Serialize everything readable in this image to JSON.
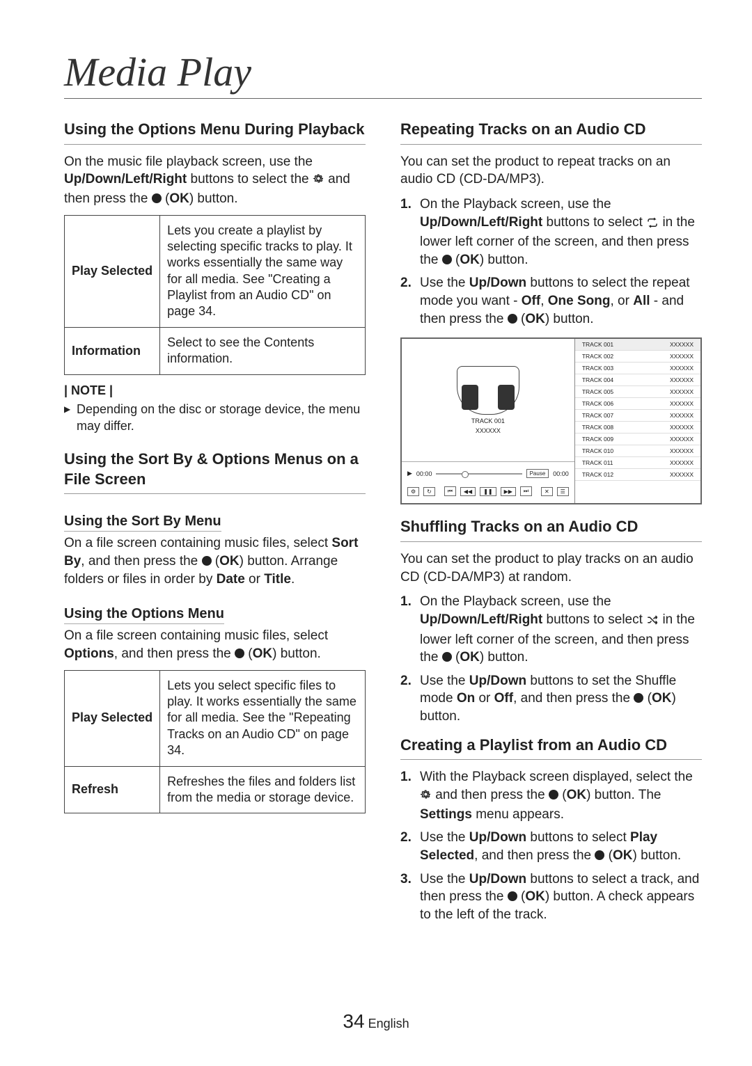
{
  "page_title": "Media Play",
  "footer": {
    "page_number": "34",
    "language": "English"
  },
  "left": {
    "sec1_title": "Using the Options Menu During Playback",
    "sec1_body_parts": [
      "On the music file playback screen, use the ",
      "Up/Down/Left/Right",
      " buttons to select the ",
      " and then press the ",
      " (",
      "OK",
      ") button."
    ],
    "table1": {
      "r1_label": "Play Selected",
      "r1_desc": "Lets you create a playlist by selecting specific tracks to play. It works essentially the same way for all media. See \"Creating a Playlist from an Audio CD\" on page 34.",
      "r2_label": "Information",
      "r2_desc": "Select to see the Contents information."
    },
    "note_hd": "| NOTE |",
    "note_body": "Depending on the disc or storage device, the menu may differ.",
    "sec2_title": "Using the Sort By & Options Menus on a File Screen",
    "sub1_title": "Using the Sort By Menu",
    "sub1_body_parts": [
      "On a file screen containing music files, select ",
      "Sort By",
      ", and then press the ",
      " (",
      "OK",
      ") button. Arrange folders or files in order by ",
      "Date",
      " or ",
      "Title",
      "."
    ],
    "sub2_title": "Using the Options Menu",
    "sub2_body_parts": [
      "On a file screen containing music files, select ",
      "Options",
      ", and then press the ",
      " (",
      "OK",
      ") button."
    ],
    "table2": {
      "r1_label": "Play Selected",
      "r1_desc": "Lets you select specific files to play. It works essentially the same for all media. See the \"Repeating Tracks on an Audio CD\" on page 34.",
      "r2_label": "Refresh",
      "r2_desc": "Refreshes the files and folders list from the media or storage device."
    }
  },
  "right": {
    "sec1_title": "Repeating Tracks on an Audio CD",
    "sec1_intro": "You can set the product to repeat tracks on an audio CD (CD-DA/MP3).",
    "sec1_s1": [
      "On the Playback screen, use the ",
      "Up/Down/Left/Right",
      " buttons to select ",
      " in the lower left corner of the screen, and then press the ",
      " (",
      "OK",
      ") button."
    ],
    "sec1_s2": [
      "Use the ",
      "Up/Down",
      " buttons to select the repeat mode you want - ",
      "Off",
      ", ",
      "One Song",
      ", or ",
      "All",
      " - and then press the ",
      " (",
      "OK",
      ") button."
    ],
    "shot": {
      "now_track": "TRACK 001",
      "now_sub": "XXXXXX",
      "time_l": "00:00",
      "time_r": "00:00",
      "pause": "Pause",
      "tracks": [
        {
          "t": "TRACK 001",
          "v": "XXXXXX",
          "hl": true
        },
        {
          "t": "TRACK 002",
          "v": "XXXXXX"
        },
        {
          "t": "TRACK 003",
          "v": "XXXXXX"
        },
        {
          "t": "TRACK 004",
          "v": "XXXXXX"
        },
        {
          "t": "TRACK 005",
          "v": "XXXXXX"
        },
        {
          "t": "TRACK 006",
          "v": "XXXXXX"
        },
        {
          "t": "TRACK 007",
          "v": "XXXXXX"
        },
        {
          "t": "TRACK 008",
          "v": "XXXXXX"
        },
        {
          "t": "TRACK 009",
          "v": "XXXXXX"
        },
        {
          "t": "TRACK 010",
          "v": "XXXXXX"
        },
        {
          "t": "TRACK 011",
          "v": "XXXXXX"
        },
        {
          "t": "TRACK 012",
          "v": "XXXXXX"
        }
      ]
    },
    "sec2_title": "Shuffling Tracks on an Audio CD",
    "sec2_intro": "You can set the product to play tracks on an audio CD (CD-DA/MP3) at random.",
    "sec2_s1": [
      "On the Playback screen, use the ",
      "Up/Down/Left/Right",
      " buttons to select ",
      " in the lower left corner of the screen, and then press the ",
      " (",
      "OK",
      ") button."
    ],
    "sec2_s2": [
      "Use the ",
      "Up/Down",
      " buttons to set the Shuffle mode ",
      "On",
      " or ",
      "Off",
      ", and then press the ",
      " (",
      "OK",
      ") button."
    ],
    "sec3_title": "Creating a Playlist from an Audio CD",
    "sec3_s1": [
      "With the Playback screen displayed, select the ",
      " and then press the ",
      " (",
      "OK",
      ") button. The ",
      "Settings",
      " menu appears."
    ],
    "sec3_s2": [
      "Use the ",
      "Up/Down",
      " buttons to select ",
      "Play Selected",
      ", and then press the ",
      " (",
      "OK",
      ") button."
    ],
    "sec3_s3": [
      "Use the ",
      "Up/Down",
      " buttons to select a track, and then press the ",
      " (",
      "OK",
      ") button. A check appears to the left of the track."
    ]
  }
}
